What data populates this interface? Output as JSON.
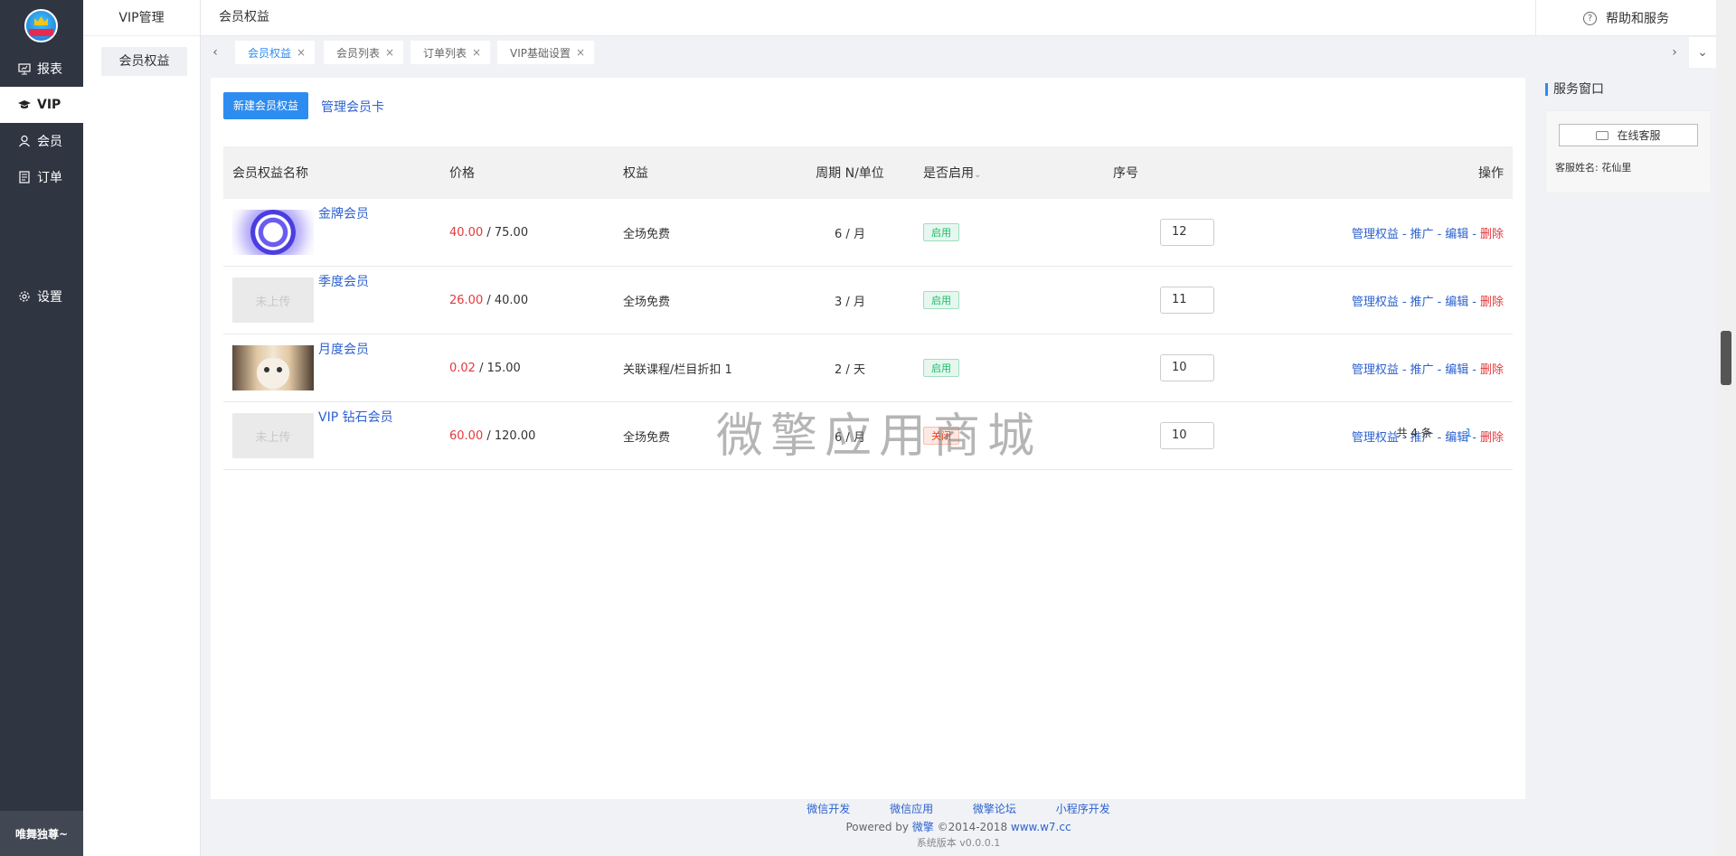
{
  "sidebar": {
    "items": [
      {
        "label": "报表",
        "icon": "chart-board-icon"
      },
      {
        "label": "VIP",
        "icon": "graduation-cap-icon"
      },
      {
        "label": "会员",
        "icon": "user-icon"
      },
      {
        "label": "订单",
        "icon": "order-list-icon"
      },
      {
        "label": "设置",
        "icon": "gear-icon"
      }
    ],
    "active": "VIP",
    "user_name": "唯舞独尊~"
  },
  "subside": {
    "title": "VIP管理",
    "item": "会员权益"
  },
  "topbar": {
    "breadcrumb": "会员权益",
    "help": "帮助和服务"
  },
  "tabs": [
    {
      "label": "会员权益",
      "active": true
    },
    {
      "label": "会员列表",
      "active": false
    },
    {
      "label": "订单列表",
      "active": false
    },
    {
      "label": "VIP基础设置",
      "active": false
    }
  ],
  "toolbar": {
    "new_button": "新建会员权益",
    "manage_link": "管理会员卡"
  },
  "table": {
    "headers": [
      "会员权益名称",
      "价格",
      "权益",
      "周期 N/单位",
      "是否启用",
      "序号",
      "操作"
    ],
    "rows": [
      {
        "name": "金牌会员",
        "thumb": "",
        "price_sale": "40.00",
        "price_orig": "75.00",
        "benefit": "全场免费",
        "period": "6 / 月",
        "status": "启用",
        "seq": "12"
      },
      {
        "name": "季度会员",
        "thumb": "未上传",
        "price_sale": "26.00",
        "price_orig": "40.00",
        "benefit": "全场免费",
        "period": "3 / 月",
        "status": "启用",
        "seq": "11"
      },
      {
        "name": "月度会员",
        "thumb": "",
        "price_sale": "0.02",
        "price_orig": "15.00",
        "benefit": "关联课程/栏目折扣 1",
        "period": "2 / 天",
        "status": "启用",
        "seq": "10"
      },
      {
        "name": "VIP 钻石会员",
        "thumb": "未上传",
        "price_sale": "60.00",
        "price_orig": "120.00",
        "benefit": "全场免费",
        "period": "6 / 月",
        "status": "关闭",
        "seq": "10"
      }
    ],
    "actions": {
      "manage": "管理权益",
      "promote": "推广",
      "edit": "编辑",
      "delete": "删除",
      "sep": "-"
    }
  },
  "pager": {
    "total": "共 4 条",
    "current": "1"
  },
  "watermark": "微擎应用商城",
  "service": {
    "title": "服务窗口",
    "button": "在线客服",
    "name": "客服姓名:  花仙里"
  },
  "footer": {
    "links": [
      "微信开发",
      "微信应用",
      "微擎论坛",
      "小程序开发"
    ],
    "powered": "Powered by",
    "brand": "微擎",
    "copyright": "©2014-2018",
    "site": "www.w7.cc",
    "version": "系统版本 v0.0.0.1"
  },
  "colors": {
    "accent": "#2d8cf0",
    "sidebar": "#2f3541",
    "price": "#e4393c",
    "enabled": "#19be6b",
    "disabled": "#ed4014"
  }
}
